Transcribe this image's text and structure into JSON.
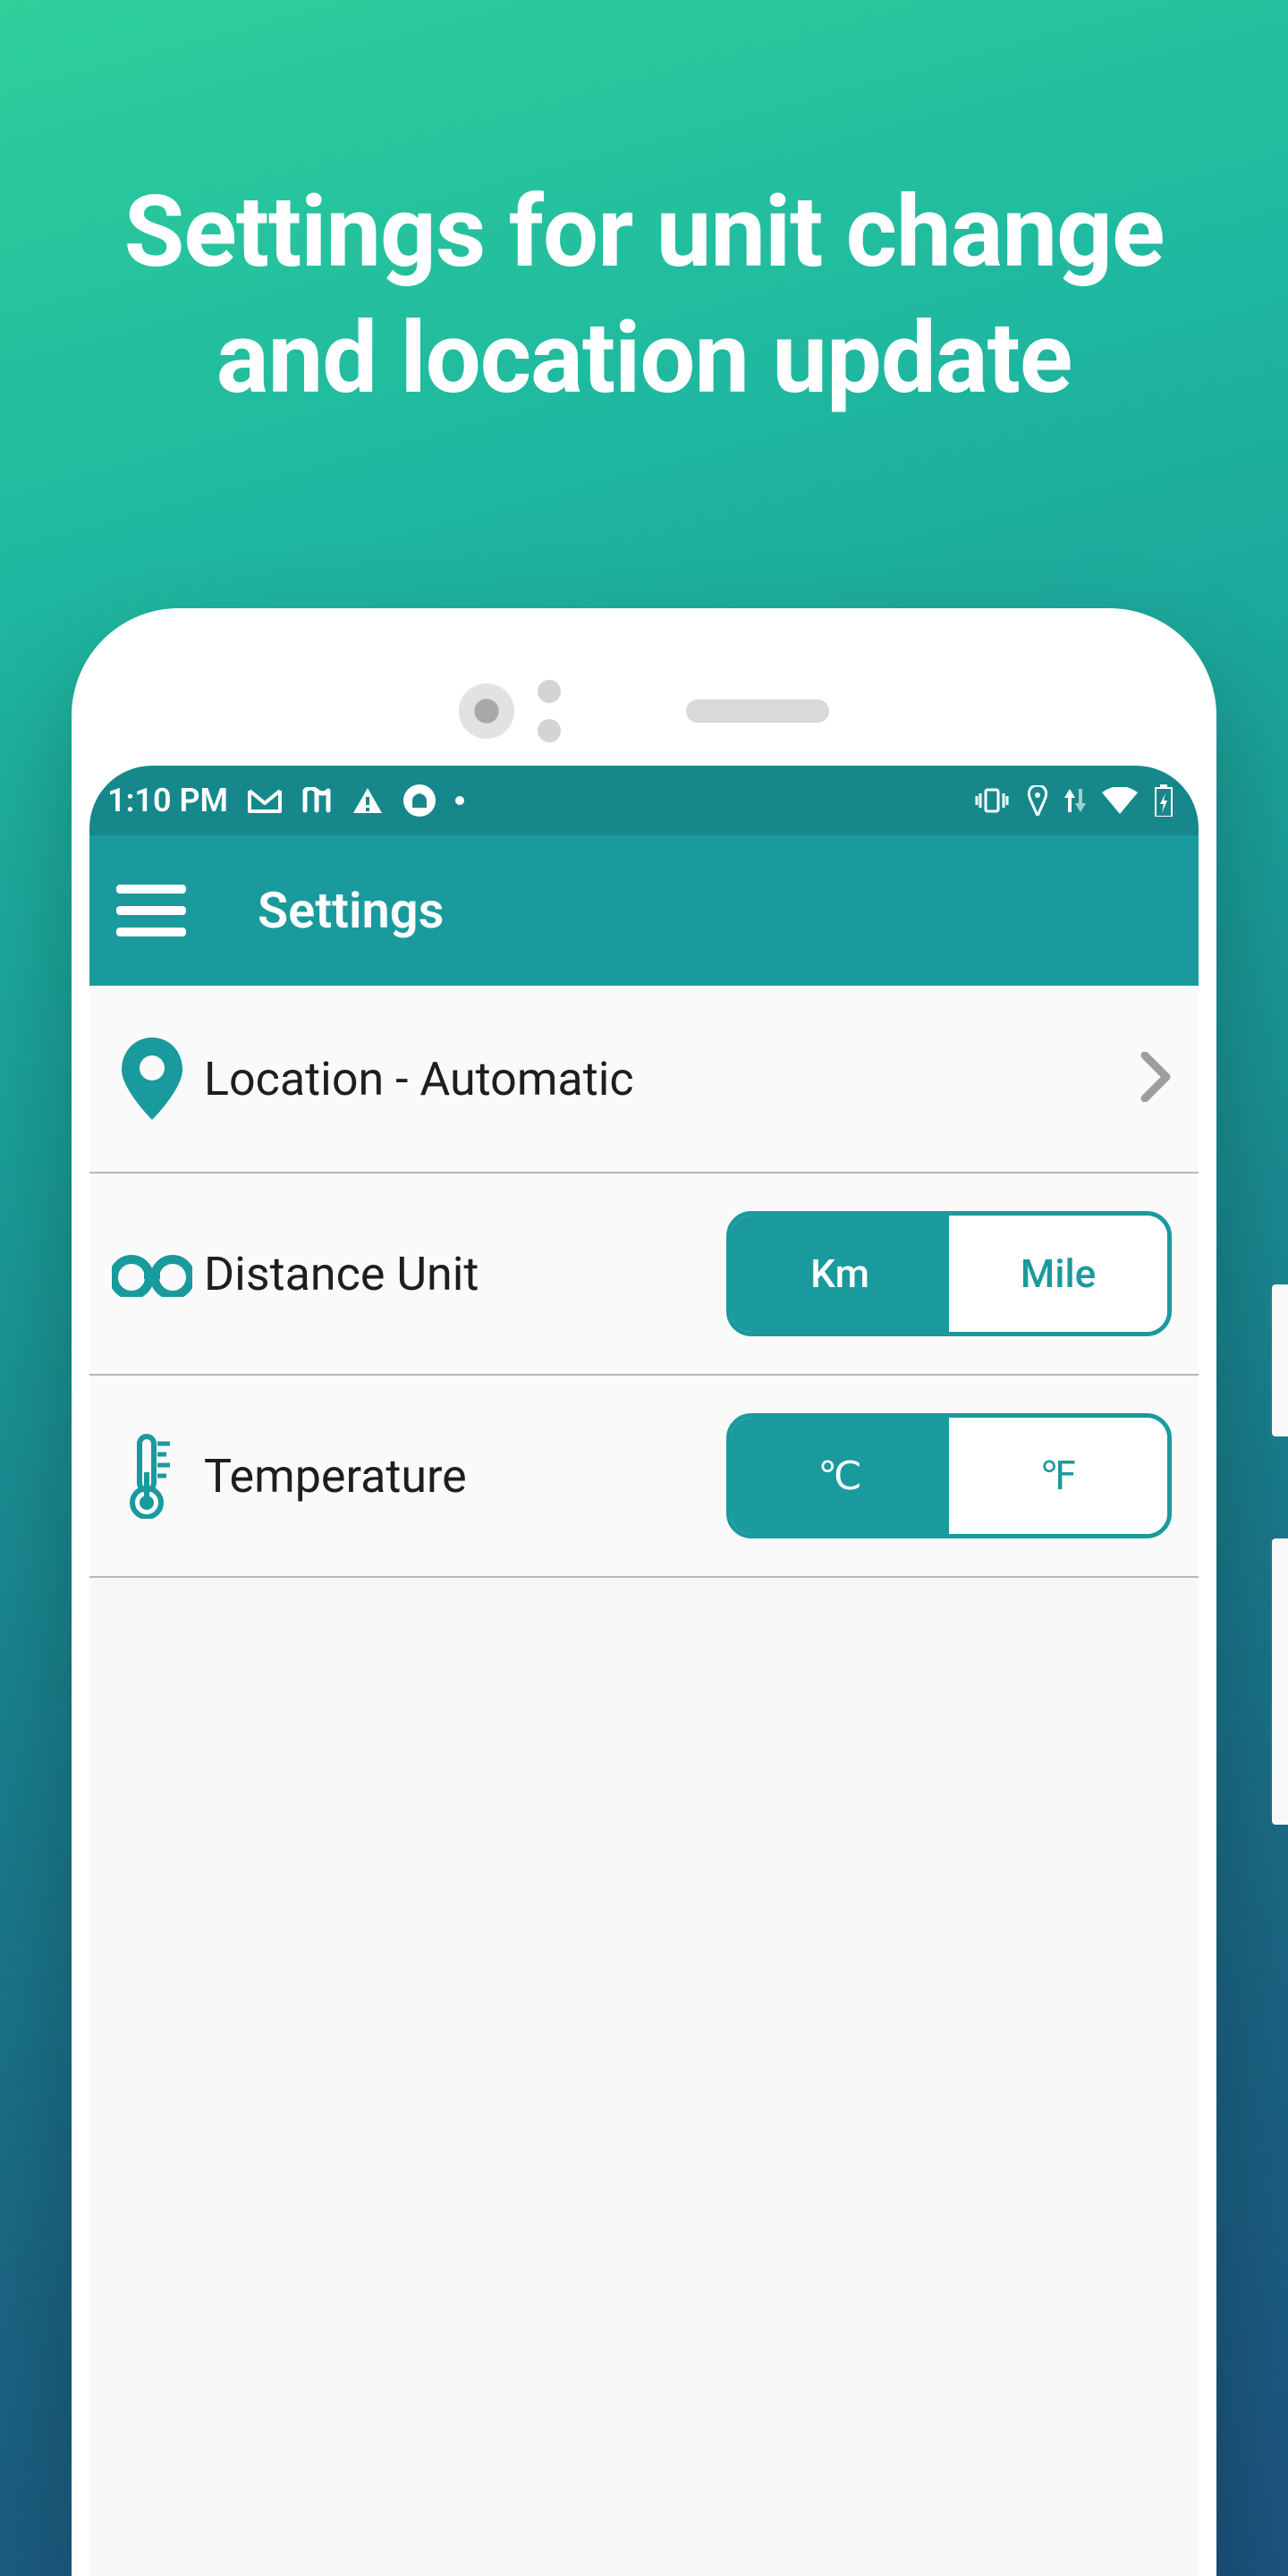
{
  "marketing": {
    "headline_line1": "Settings for unit change",
    "headline_line2": "and location update"
  },
  "statusbar": {
    "time": "1:10 PM"
  },
  "appbar": {
    "title": "Settings"
  },
  "rows": {
    "location": {
      "label": "Location - Automatic"
    },
    "distance": {
      "label": "Distance Unit",
      "options": {
        "km": "Km",
        "mile": "Mile"
      },
      "selected": "km"
    },
    "temperature": {
      "label": "Temperature",
      "options": {
        "c": "℃",
        "f": "℉"
      },
      "selected": "c"
    }
  }
}
